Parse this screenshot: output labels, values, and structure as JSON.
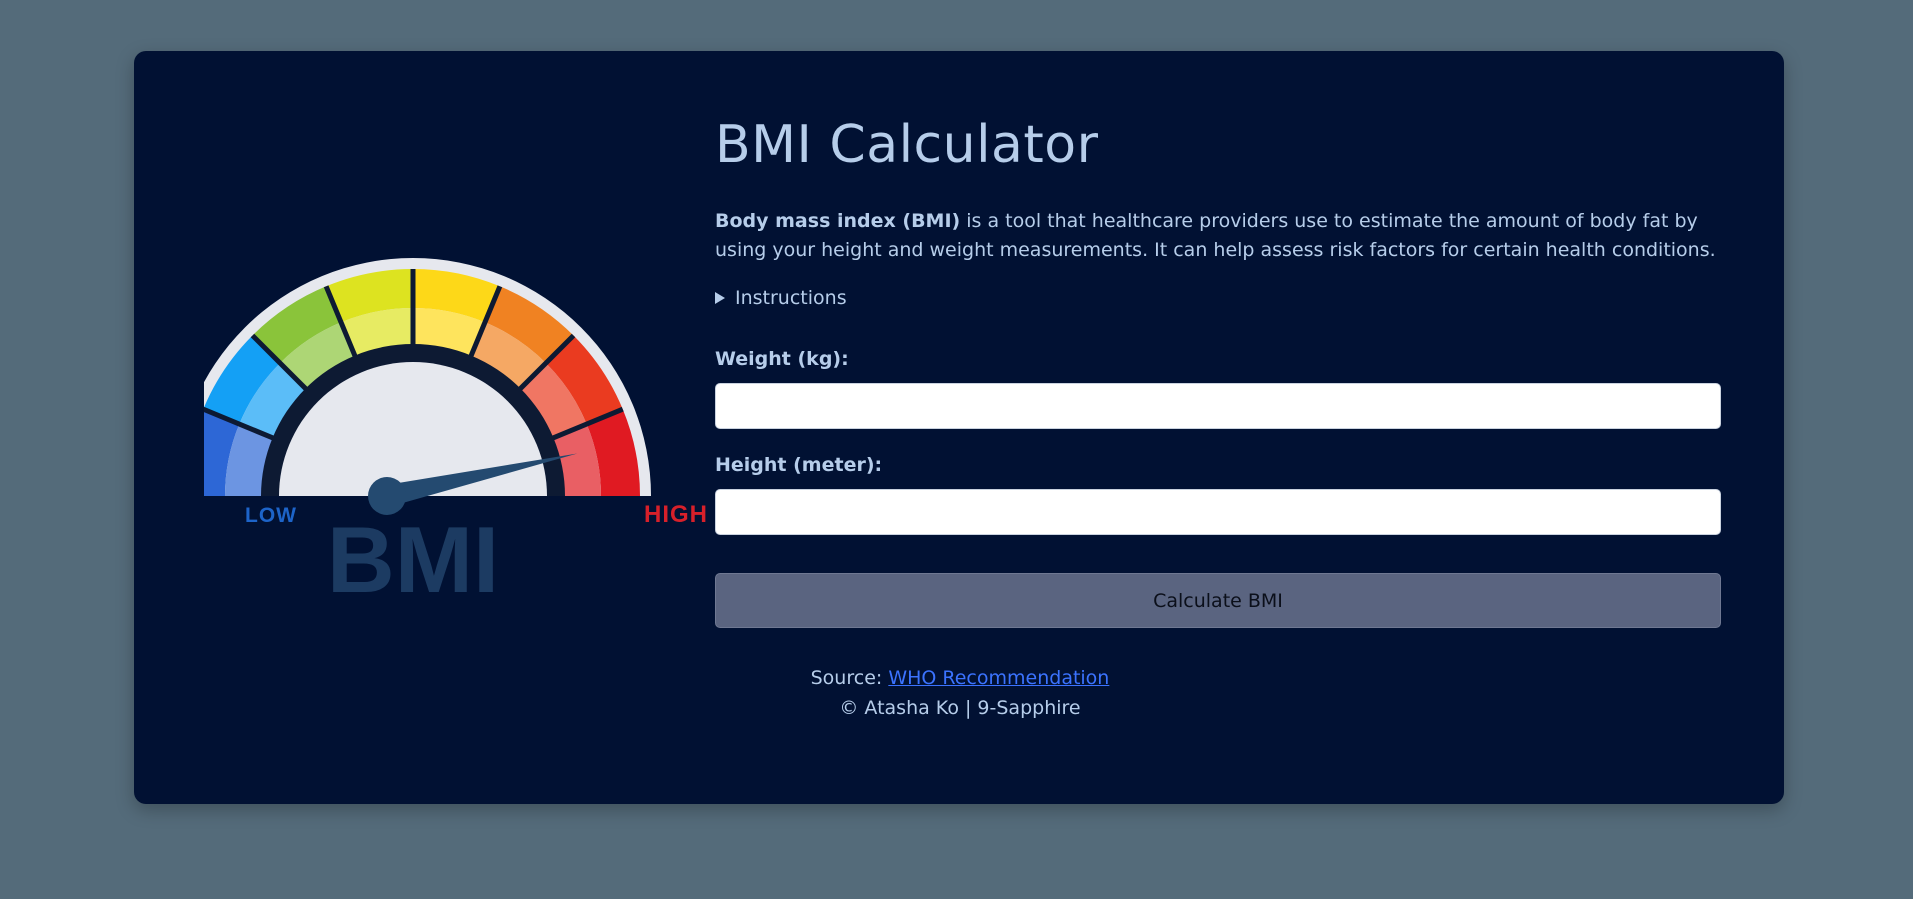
{
  "colors": {
    "page_background": "#546b7a",
    "card_background": "#011133",
    "text": "#b6cdea",
    "link": "#3b73ff",
    "button_background": "#5a6480"
  },
  "gauge": {
    "low_label": "LOW",
    "high_label": "HIGH",
    "big_label": "BMI",
    "needle_level": 0.93,
    "segment_colors": [
      "#2d67d6",
      "#14a0f5",
      "#8ac43a",
      "#dde320",
      "#fdd818",
      "#f08222",
      "#ea3b20",
      "#e01a22"
    ],
    "low_color": "#1d64c9",
    "high_color": "#d7202a",
    "big_label_color": "#1c3b62"
  },
  "header": {
    "title": "BMI Calculator"
  },
  "intro": {
    "bold": "Body mass index (BMI)",
    "rest": " is a tool that healthcare providers use to estimate the amount of body fat by using your height and weight measurements. It can help assess risk factors for certain health conditions."
  },
  "instructions": {
    "label": "Instructions"
  },
  "form": {
    "weight_label": "Weight (kg):",
    "weight_value": "",
    "height_label": "Height (meter):",
    "height_value": "",
    "calculate_label": "Calculate BMI"
  },
  "footer": {
    "source_prefix": "Source: ",
    "source_link": "WHO Recommendation",
    "credit": "© Atasha Ko | 9-Sapphire"
  }
}
